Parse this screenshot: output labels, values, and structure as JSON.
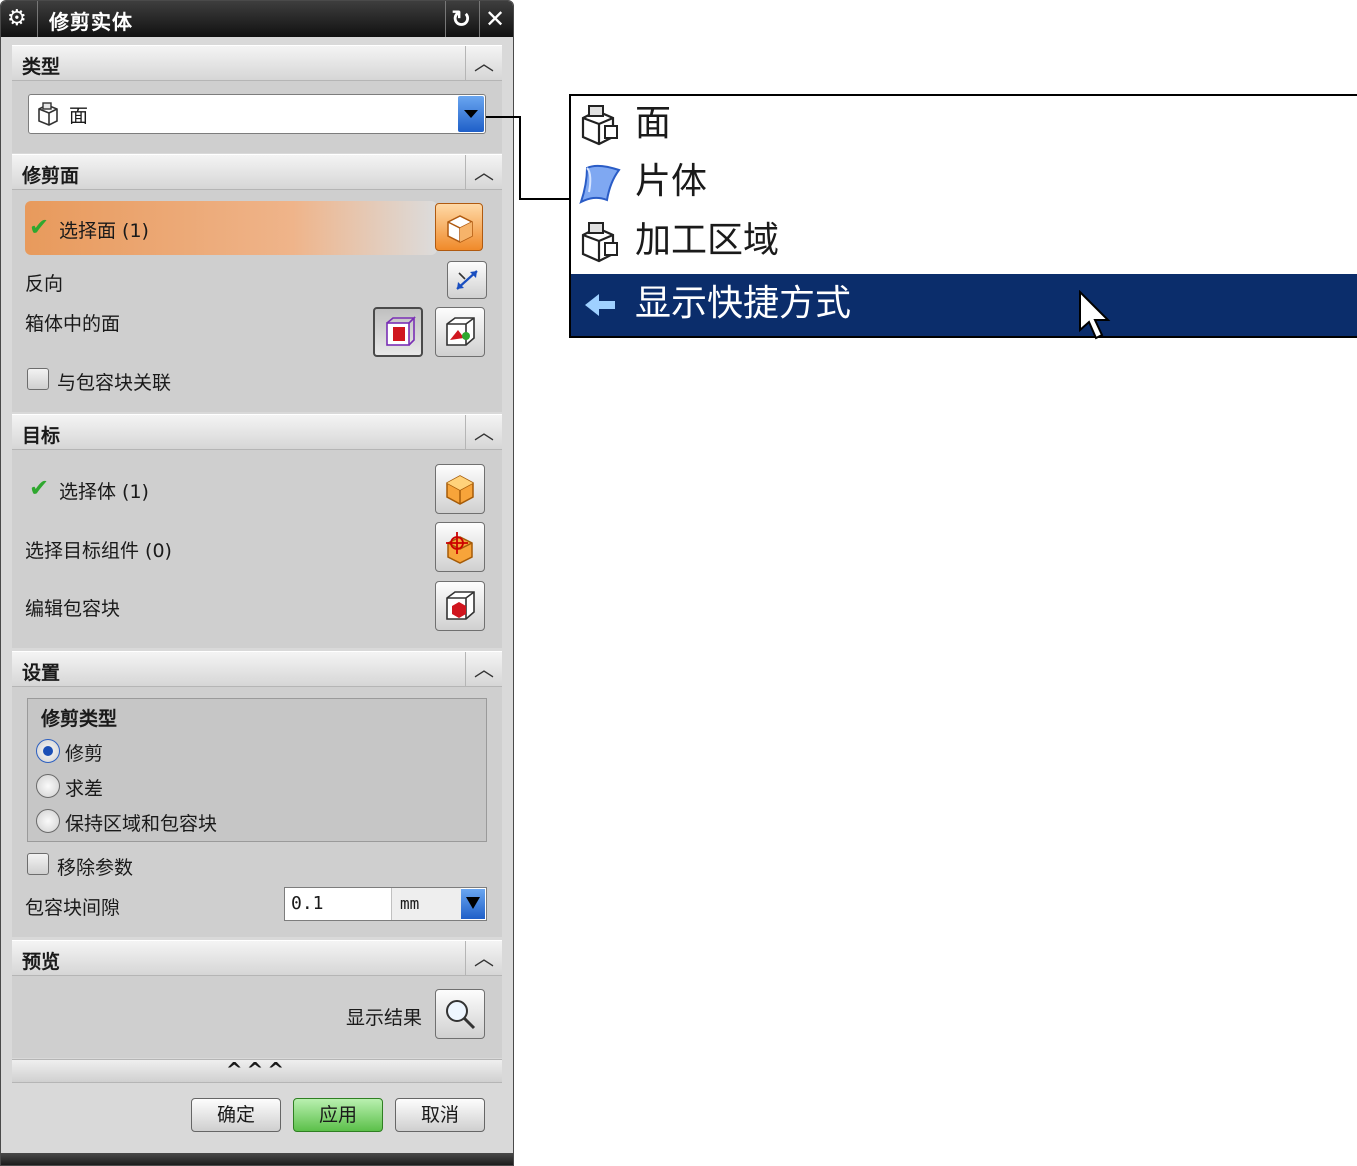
{
  "dialog": {
    "title": "修剪实体",
    "sections": {
      "type": {
        "label": "类型",
        "combo_value": "面"
      },
      "trim_face": {
        "label": "修剪面",
        "select_face": "选择面 (1)",
        "reverse": "反向",
        "faces_in_box": "箱体中的面",
        "associate_box": "与包容块关联"
      },
      "target": {
        "label": "目标",
        "select_body": "选择体 (1)",
        "select_component": "选择目标组件 (0)",
        "edit_box": "编辑包容块"
      },
      "settings": {
        "label": "设置",
        "trim_type_label": "修剪类型",
        "options": [
          "修剪",
          "求差",
          "保持区域和包容块"
        ],
        "selected_option": "修剪",
        "remove_params": "移除参数",
        "box_gap_label": "包容块间隙",
        "box_gap_value": "0.1",
        "box_gap_unit": "mm"
      },
      "preview": {
        "label": "预览",
        "show_result": "显示结果"
      }
    },
    "more": "^^^",
    "buttons": {
      "ok": "确定",
      "apply": "应用",
      "cancel": "取消"
    }
  },
  "dropdown_menu": {
    "items": [
      {
        "label": "面",
        "icon": "face-type-icon"
      },
      {
        "label": "片体",
        "icon": "sheet-body-icon"
      },
      {
        "label": "加工区域",
        "icon": "machining-region-icon"
      },
      {
        "label": "显示快捷方式",
        "icon": "show-shortcuts-arrow-icon"
      }
    ],
    "highlighted": "显示快捷方式"
  },
  "colors": {
    "menu_highlight": "#0b2d6b",
    "title_bar": "#111111",
    "apply_button": "#5cc04a",
    "selection_row": "#e89a5c"
  }
}
